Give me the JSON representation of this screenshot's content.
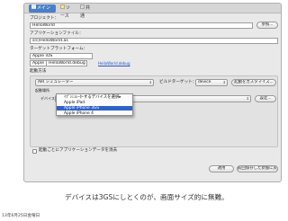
{
  "tabs": [
    {
      "label": "メイン"
    },
    {
      "label": "ソース"
    },
    {
      "label": "共通"
    }
  ],
  "project": {
    "label": "プロジェクト：",
    "value": "HelloWorld",
    "browse": "参照..."
  },
  "app_file": {
    "label": "アプリケーションファイル：",
    "value": "src/HelloWorld.as"
  },
  "target_platform": {
    "label": "ターゲットプラットフォーム：",
    "items": [
      "Apple iOS",
      "Apple"
    ],
    "link": "HelloWorld.debug"
  },
  "launch": {
    "section_label": "起動方法",
    "method_value": "AIR シミュレーター",
    "build_target_label": "ビルドターゲット：",
    "build_target_value": "device",
    "customize_button": "起動をカスタマイズ...",
    "device_label": "起動場所",
    "setting_label": "デバイス",
    "config_button": "設定..."
  },
  "device_dropdown": {
    "items": [
      "ｲﾌﾟｼﾐｭﾚｰﾀｰするデバイスを選択▸",
      "Apple iPad",
      "Apple iPhone 3GS",
      "Apple iPhone 4"
    ],
    "selected_index": 2
  },
  "clear_data": {
    "label": "起動ごとにアプリケーションデータを消去"
  },
  "bottom_buttons": {
    "apply": "適用",
    "revert": "前回保存した状態に戻"
  },
  "caption": "デバイスは3GSにしとくのが、画面サイズ的に無難。",
  "footer": "13年6月25日金曜日"
}
